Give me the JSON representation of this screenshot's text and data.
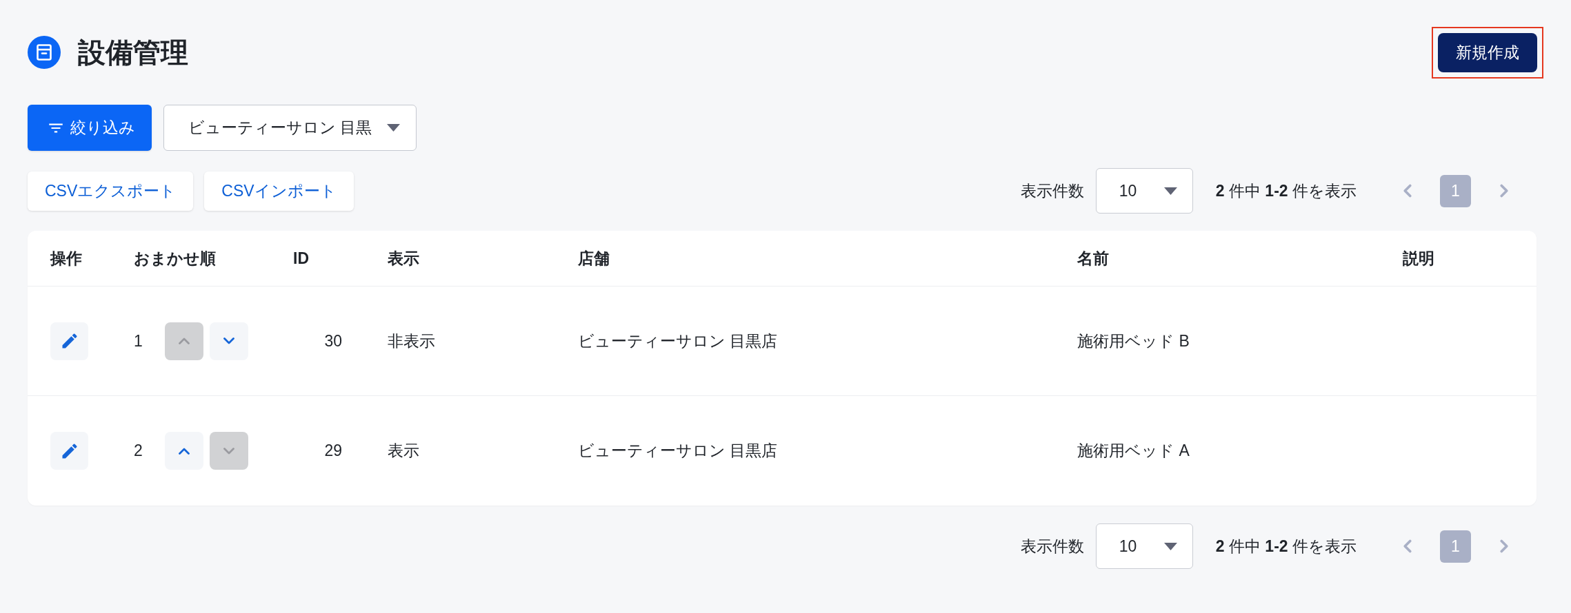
{
  "header": {
    "title": "設備管理",
    "new_button": {
      "label": "新規作成",
      "highlighted": true
    }
  },
  "filter": {
    "button": "絞り込み",
    "store_select": {
      "value": "ビューティーサロン 目黒"
    }
  },
  "actions": [
    "CSVエクスポート",
    "CSVインポート"
  ],
  "pagination_top": {
    "per_page_label": "表示件数",
    "per_page": "10",
    "summary": "**2** 件中 **1-2** 件を表示",
    "prev_disabled": true,
    "pages": [
      {
        "label": "1",
        "selected": true
      }
    ],
    "next_disabled": true
  },
  "table": {
    "columns": [
      "操作",
      "おまかせ順",
      "ID",
      "表示",
      "店舗",
      "名前",
      "説明"
    ],
    "rows": [
      {
        "order": "1",
        "up_disabled": true,
        "down_disabled": false,
        "id": "30",
        "visibility": "非表示",
        "store": "ビューティーサロン 目黒店",
        "name": "施術用ベッド B"
      },
      {
        "order": "2",
        "up_disabled": false,
        "down_disabled": true,
        "id": "29",
        "visibility": "表示",
        "store": "ビューティーサロン 目黒店",
        "name": "施術用ベッド A"
      }
    ]
  },
  "pagination_bottom": {
    "per_page_label": "表示件数",
    "per_page": "10",
    "summary": "**2** 件中 **1-2** 件を表示",
    "prev_disabled": true,
    "pages": [
      {
        "label": "1",
        "selected": true
      }
    ],
    "next_disabled": true
  }
}
